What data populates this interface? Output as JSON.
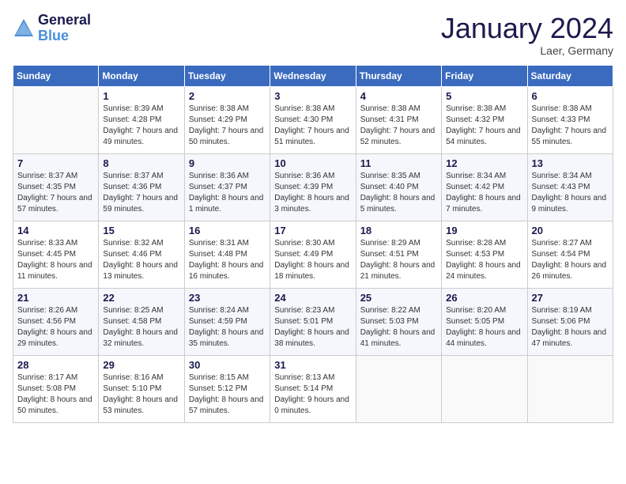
{
  "header": {
    "logo_line1": "General",
    "logo_line2": "Blue",
    "month_title": "January 2024",
    "location": "Laer, Germany"
  },
  "days_of_week": [
    "Sunday",
    "Monday",
    "Tuesday",
    "Wednesday",
    "Thursday",
    "Friday",
    "Saturday"
  ],
  "weeks": [
    [
      {
        "day": "",
        "sunrise": "",
        "sunset": "",
        "daylight": ""
      },
      {
        "day": "1",
        "sunrise": "Sunrise: 8:39 AM",
        "sunset": "Sunset: 4:28 PM",
        "daylight": "Daylight: 7 hours and 49 minutes."
      },
      {
        "day": "2",
        "sunrise": "Sunrise: 8:38 AM",
        "sunset": "Sunset: 4:29 PM",
        "daylight": "Daylight: 7 hours and 50 minutes."
      },
      {
        "day": "3",
        "sunrise": "Sunrise: 8:38 AM",
        "sunset": "Sunset: 4:30 PM",
        "daylight": "Daylight: 7 hours and 51 minutes."
      },
      {
        "day": "4",
        "sunrise": "Sunrise: 8:38 AM",
        "sunset": "Sunset: 4:31 PM",
        "daylight": "Daylight: 7 hours and 52 minutes."
      },
      {
        "day": "5",
        "sunrise": "Sunrise: 8:38 AM",
        "sunset": "Sunset: 4:32 PM",
        "daylight": "Daylight: 7 hours and 54 minutes."
      },
      {
        "day": "6",
        "sunrise": "Sunrise: 8:38 AM",
        "sunset": "Sunset: 4:33 PM",
        "daylight": "Daylight: 7 hours and 55 minutes."
      }
    ],
    [
      {
        "day": "7",
        "sunrise": "Sunrise: 8:37 AM",
        "sunset": "Sunset: 4:35 PM",
        "daylight": "Daylight: 7 hours and 57 minutes."
      },
      {
        "day": "8",
        "sunrise": "Sunrise: 8:37 AM",
        "sunset": "Sunset: 4:36 PM",
        "daylight": "Daylight: 7 hours and 59 minutes."
      },
      {
        "day": "9",
        "sunrise": "Sunrise: 8:36 AM",
        "sunset": "Sunset: 4:37 PM",
        "daylight": "Daylight: 8 hours and 1 minute."
      },
      {
        "day": "10",
        "sunrise": "Sunrise: 8:36 AM",
        "sunset": "Sunset: 4:39 PM",
        "daylight": "Daylight: 8 hours and 3 minutes."
      },
      {
        "day": "11",
        "sunrise": "Sunrise: 8:35 AM",
        "sunset": "Sunset: 4:40 PM",
        "daylight": "Daylight: 8 hours and 5 minutes."
      },
      {
        "day": "12",
        "sunrise": "Sunrise: 8:34 AM",
        "sunset": "Sunset: 4:42 PM",
        "daylight": "Daylight: 8 hours and 7 minutes."
      },
      {
        "day": "13",
        "sunrise": "Sunrise: 8:34 AM",
        "sunset": "Sunset: 4:43 PM",
        "daylight": "Daylight: 8 hours and 9 minutes."
      }
    ],
    [
      {
        "day": "14",
        "sunrise": "Sunrise: 8:33 AM",
        "sunset": "Sunset: 4:45 PM",
        "daylight": "Daylight: 8 hours and 11 minutes."
      },
      {
        "day": "15",
        "sunrise": "Sunrise: 8:32 AM",
        "sunset": "Sunset: 4:46 PM",
        "daylight": "Daylight: 8 hours and 13 minutes."
      },
      {
        "day": "16",
        "sunrise": "Sunrise: 8:31 AM",
        "sunset": "Sunset: 4:48 PM",
        "daylight": "Daylight: 8 hours and 16 minutes."
      },
      {
        "day": "17",
        "sunrise": "Sunrise: 8:30 AM",
        "sunset": "Sunset: 4:49 PM",
        "daylight": "Daylight: 8 hours and 18 minutes."
      },
      {
        "day": "18",
        "sunrise": "Sunrise: 8:29 AM",
        "sunset": "Sunset: 4:51 PM",
        "daylight": "Daylight: 8 hours and 21 minutes."
      },
      {
        "day": "19",
        "sunrise": "Sunrise: 8:28 AM",
        "sunset": "Sunset: 4:53 PM",
        "daylight": "Daylight: 8 hours and 24 minutes."
      },
      {
        "day": "20",
        "sunrise": "Sunrise: 8:27 AM",
        "sunset": "Sunset: 4:54 PM",
        "daylight": "Daylight: 8 hours and 26 minutes."
      }
    ],
    [
      {
        "day": "21",
        "sunrise": "Sunrise: 8:26 AM",
        "sunset": "Sunset: 4:56 PM",
        "daylight": "Daylight: 8 hours and 29 minutes."
      },
      {
        "day": "22",
        "sunrise": "Sunrise: 8:25 AM",
        "sunset": "Sunset: 4:58 PM",
        "daylight": "Daylight: 8 hours and 32 minutes."
      },
      {
        "day": "23",
        "sunrise": "Sunrise: 8:24 AM",
        "sunset": "Sunset: 4:59 PM",
        "daylight": "Daylight: 8 hours and 35 minutes."
      },
      {
        "day": "24",
        "sunrise": "Sunrise: 8:23 AM",
        "sunset": "Sunset: 5:01 PM",
        "daylight": "Daylight: 8 hours and 38 minutes."
      },
      {
        "day": "25",
        "sunrise": "Sunrise: 8:22 AM",
        "sunset": "Sunset: 5:03 PM",
        "daylight": "Daylight: 8 hours and 41 minutes."
      },
      {
        "day": "26",
        "sunrise": "Sunrise: 8:20 AM",
        "sunset": "Sunset: 5:05 PM",
        "daylight": "Daylight: 8 hours and 44 minutes."
      },
      {
        "day": "27",
        "sunrise": "Sunrise: 8:19 AM",
        "sunset": "Sunset: 5:06 PM",
        "daylight": "Daylight: 8 hours and 47 minutes."
      }
    ],
    [
      {
        "day": "28",
        "sunrise": "Sunrise: 8:17 AM",
        "sunset": "Sunset: 5:08 PM",
        "daylight": "Daylight: 8 hours and 50 minutes."
      },
      {
        "day": "29",
        "sunrise": "Sunrise: 8:16 AM",
        "sunset": "Sunset: 5:10 PM",
        "daylight": "Daylight: 8 hours and 53 minutes."
      },
      {
        "day": "30",
        "sunrise": "Sunrise: 8:15 AM",
        "sunset": "Sunset: 5:12 PM",
        "daylight": "Daylight: 8 hours and 57 minutes."
      },
      {
        "day": "31",
        "sunrise": "Sunrise: 8:13 AM",
        "sunset": "Sunset: 5:14 PM",
        "daylight": "Daylight: 9 hours and 0 minutes."
      },
      {
        "day": "",
        "sunrise": "",
        "sunset": "",
        "daylight": ""
      },
      {
        "day": "",
        "sunrise": "",
        "sunset": "",
        "daylight": ""
      },
      {
        "day": "",
        "sunrise": "",
        "sunset": "",
        "daylight": ""
      }
    ]
  ]
}
